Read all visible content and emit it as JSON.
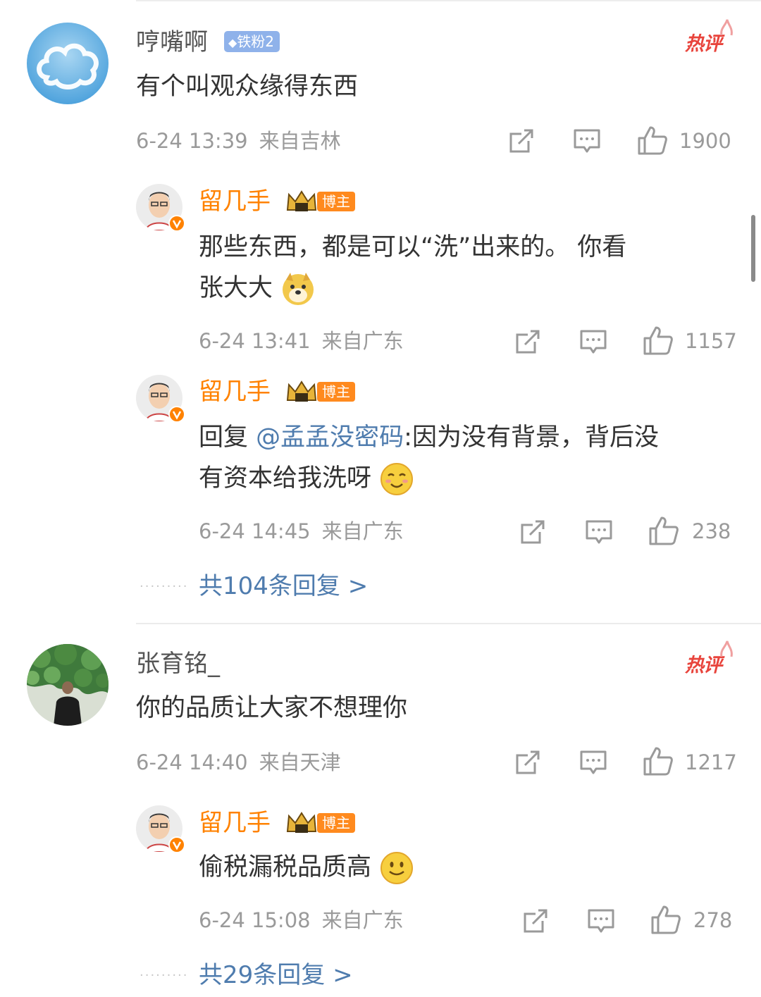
{
  "comments": [
    {
      "user": "哼嘴啊",
      "fan_badge": "铁粉2",
      "hot_label": "热评",
      "text": "有个叫观众缘得东西",
      "time": "6-24 13:39",
      "location": "来自吉林",
      "likes": "1900",
      "replies": [
        {
          "user": "留几手",
          "role_badge": "博主",
          "text": "那些东西，都是可以“洗”出来的。 你看",
          "text2": "张大大",
          "emoji": "doge-emoji",
          "time": "6-24 13:41",
          "location": "来自广东",
          "likes": "1157"
        },
        {
          "user": "留几手",
          "role_badge": "博主",
          "prefix": "回复 ",
          "mention": "@孟孟没密码",
          "text": ":因为没有背景，背后没",
          "text2": "有资本给我洗呀",
          "emoji": "blush-emoji",
          "time": "6-24 14:45",
          "location": "来自广东",
          "likes": "238"
        }
      ],
      "more_replies": "共104条回复 >"
    },
    {
      "user": "张育铭_",
      "hot_label": "热评",
      "text": "你的品质让大家不想理你",
      "time": "6-24 14:40",
      "location": "来自天津",
      "likes": "1217",
      "replies": [
        {
          "user": "留几手",
          "role_badge": "博主",
          "text": "偷税漏税品质高",
          "emoji": "smile-emoji",
          "time": "6-24 15:08",
          "location": "来自广东",
          "likes": "278"
        }
      ],
      "more_replies": "共29条回复 >"
    }
  ],
  "colors": {
    "accent_orange": "#ff8200",
    "link_blue": "#4f7cae",
    "hot_red": "#e8443c"
  }
}
